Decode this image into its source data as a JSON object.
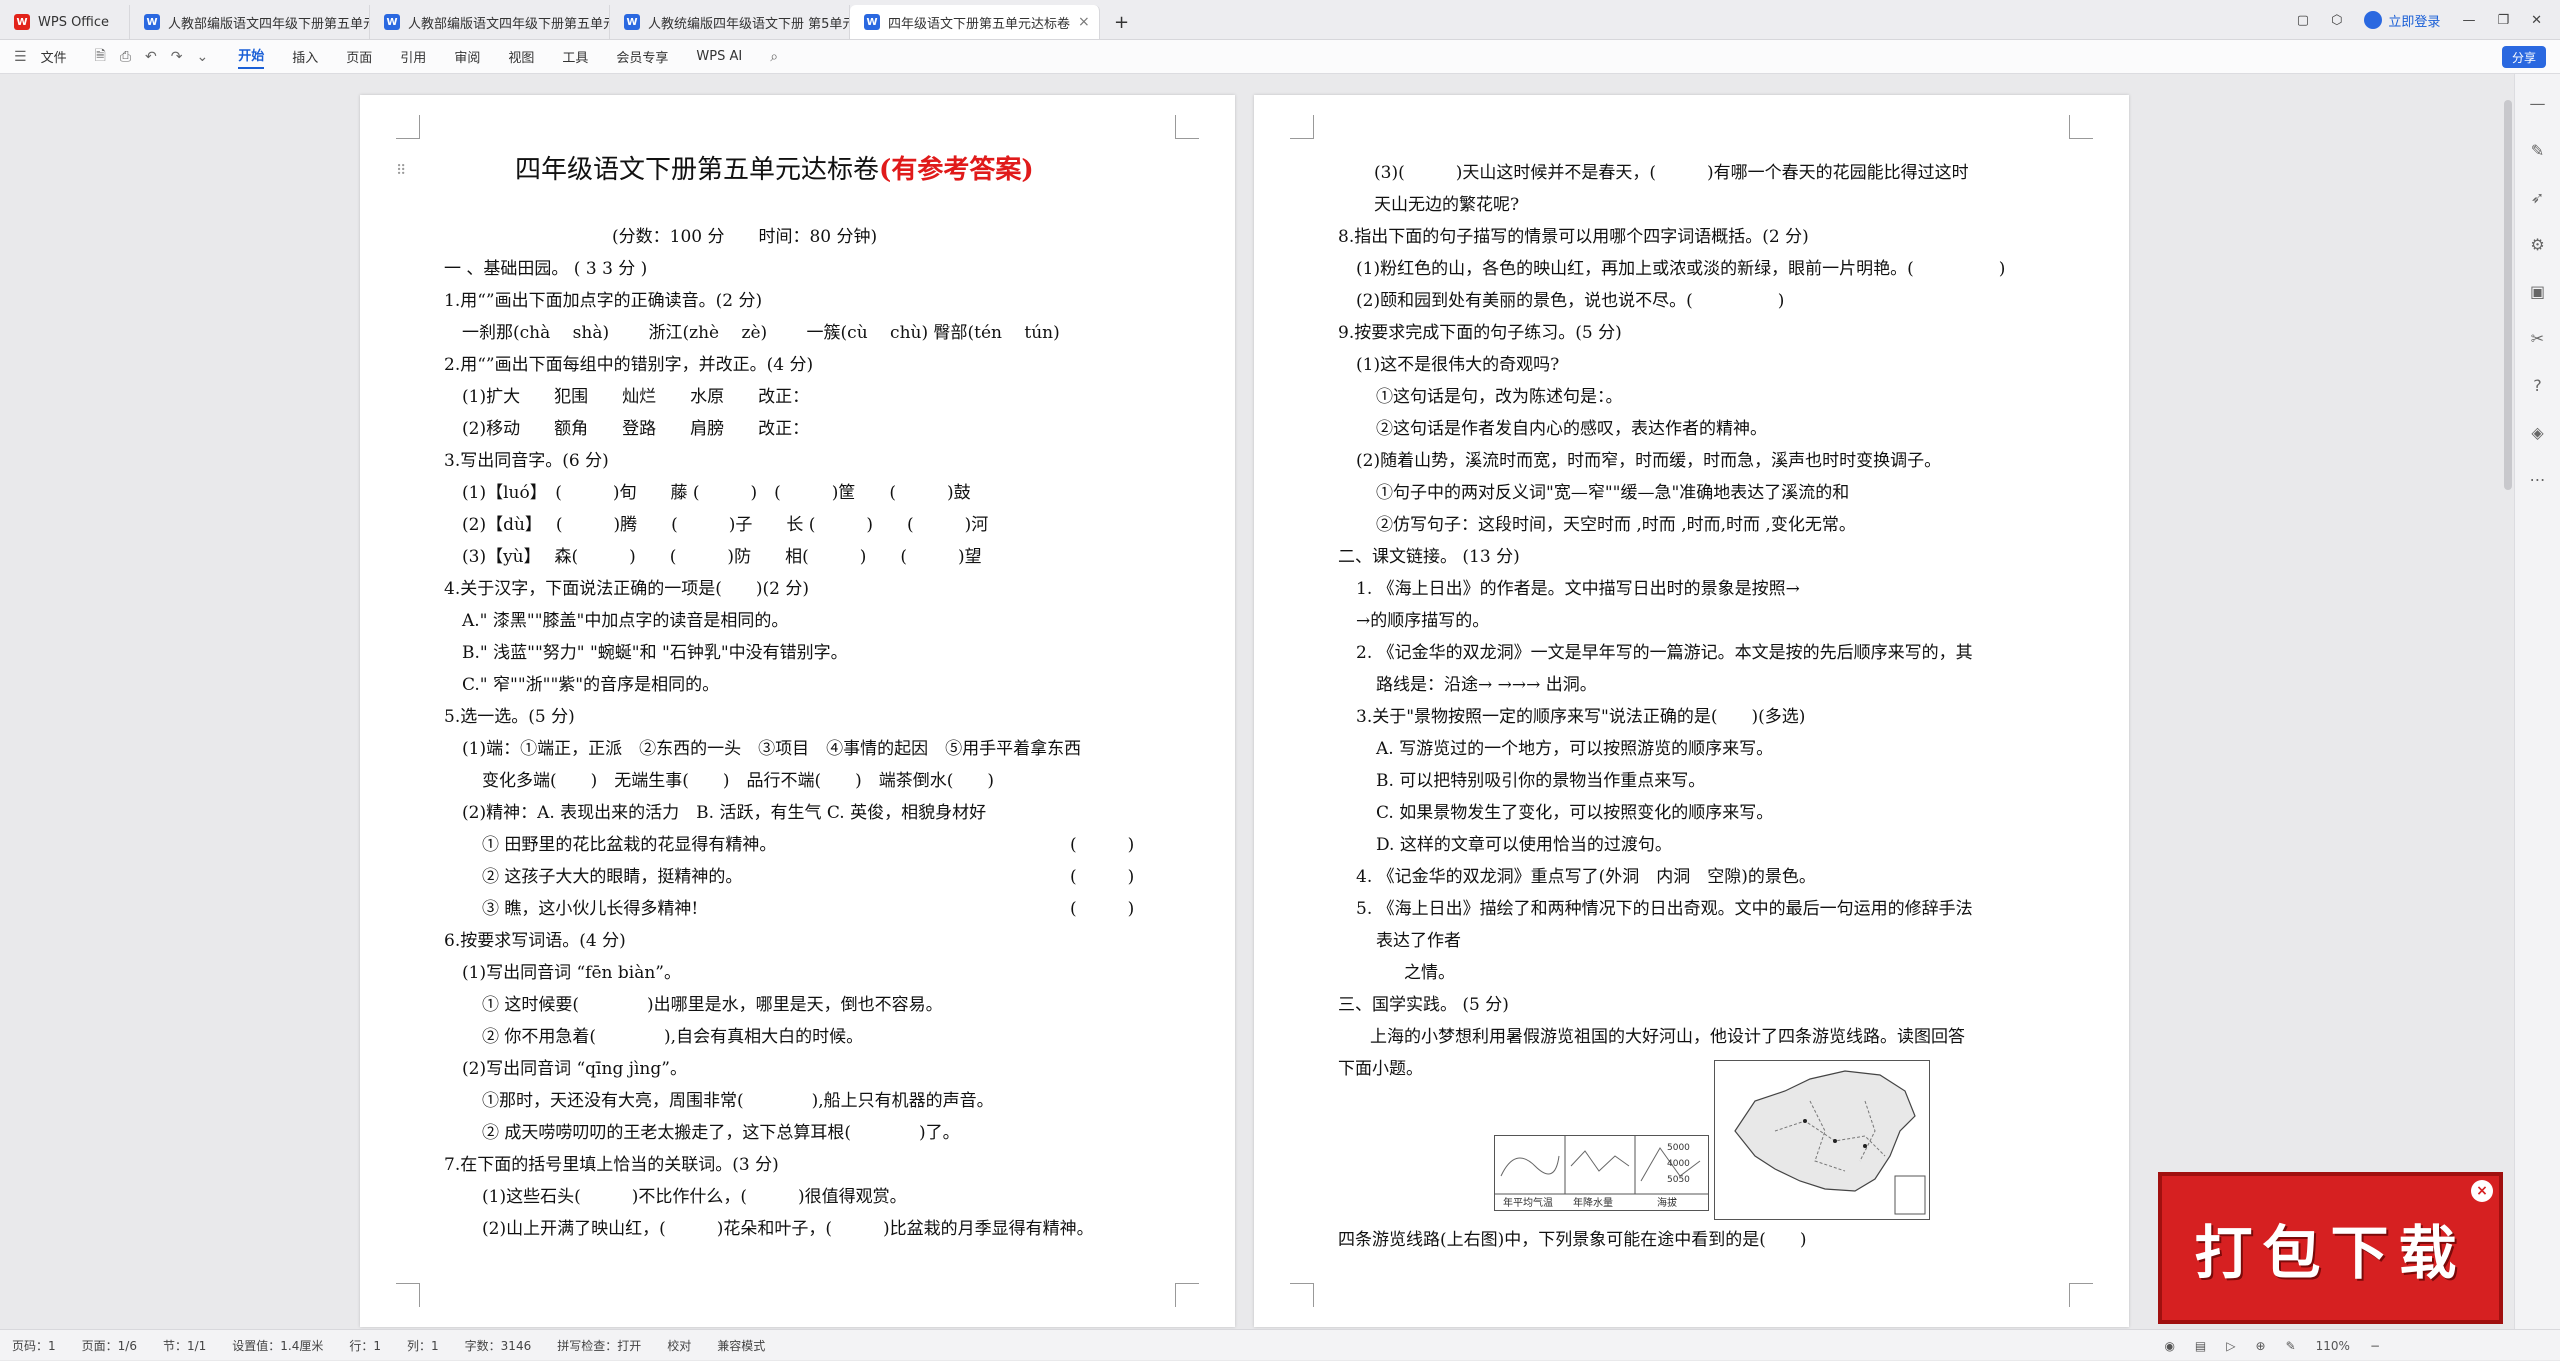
{
  "tabs": [
    {
      "label": "WPS Office",
      "icon": "wps-logo-icon",
      "color": "#e2231a"
    },
    {
      "label": "人教部编版语文四年级下册第五单元",
      "icon": "doc-icon",
      "color": "#2a68e0"
    },
    {
      "label": "人教部编版语文四年级下册第五单元",
      "icon": "doc-icon",
      "color": "#2a68e0"
    },
    {
      "label": "人教统编版四年级语文下册 第5单元",
      "icon": "doc-icon",
      "color": "#2a68e0"
    },
    {
      "label": "四年级语文下册第五单元达标卷",
      "icon": "doc-icon",
      "color": "#2a68e0"
    }
  ],
  "topbar": {
    "login_label": "立即登录"
  },
  "ribbon": {
    "file_label": "文件",
    "menus": [
      "开始",
      "插入",
      "页面",
      "引用",
      "审阅",
      "视图",
      "工具",
      "会员专享"
    ],
    "wps_ai": "WPS AI",
    "share_label": "分享"
  },
  "page1": {
    "title": "四年级语文下册第五单元达标卷",
    "title_red": "(有参考答案)",
    "lines": [
      "(分数：100 分　　时间：80 分钟)",
      "一 、基础田园。 ( 3 3  分 )",
      "1.用“”画出下面加点字的正确读音。(2 分)",
      "一刹那(chà　 shà)　　 浙江(zhè　 zè)　　 一簇(cù　 chù)  臀部(tén　 tún)",
      "2.用“”画出下面每组中的错别字，并改正。(4 分)",
      "(1)扩大　　犯围　　灿烂　　水原　　改正：",
      "(2)移动　　额角　　登路　　肩膀　　改正：",
      "3.写出同音字。(6 分)",
      "(1)【luó】　(　　　)旬　　藤 (　　　)　(　　　)筐　　(　　　)鼓",
      "(2)【dù】　 (　　　)腾　　(　　　)子　　长 (　　　)　　(　　　)河",
      "(3)【yù】　 森(　　　)　　(　　　)防　　相(　　　)　　(　　　)望",
      "4.关于汉字，下面说法正确的一项是(　　)(2 分)",
      "A.\" 漆黑\"\"膝盖\"中加点字的读音是相同的。",
      "B.\" 浅蓝\"\"努力\" \"蜿蜒\"和 \"石钟乳\"中没有错别字。",
      "C.\" 窄\"\"浙\"\"紫\"的音序是相同的。",
      "5.选一选。(5 分)",
      "(1)端：①端正，正派　②东西的一头　③项目　④事情的起因　⑤用手平着拿东西",
      "变化多端(　　)　无端生事(　　)　品行不端(　　)　端茶倒水(　　)",
      "(2)精神：A. 表现出来的活力　B. 活跃，有生气  C. 英俊，相貌身材好",
      "①  田野里的花比盆栽的花显得有精神。",
      "②  这孩子大大的眼睛，挺精神的。",
      "③  瞧，这小伙儿长得多精神!",
      "6.按要求写词语。(4 分)",
      "(1)写出同音词 “fēn biàn”。",
      "①  这时候要(　　　　)出哪里是水，哪里是天，倒也不容易。",
      "②  你不用急着(　　　　),自会有真相大白的时候。",
      "(2)写出同音词 “qīng jìng”。",
      "①那时，天还没有大亮，周围非常(　　　　),船上只有机器的声音。",
      "②  成天唠唠叨叨的王老太搬走了，这下总算耳根(　　　　)了。",
      "7.在下面的括号里填上恰当的关联词。(3 分)",
      "(1)这些石头(　　　)不比作什么，(　　　)很值得观赏。",
      "(2)山上开满了映山红，(　　　)花朵和叶子，(　　　)比盆栽的月季显得有精神。"
    ],
    "answer_parens": [
      "(　　　)",
      "(　　　)",
      "(　　　)"
    ]
  },
  "page2": {
    "lines": [
      "(3)(　　　)天山这时候并不是春天，(　　　)有哪一个春天的花园能比得过这时",
      "天山无边的繁花呢?",
      "8.指出下面的句子描写的情景可以用哪个四字词语概括。(2 分)",
      "(1)粉红色的山，各色的映山红，再加上或浓或淡的新绿，眼前一片明艳。(　　　　　)",
      "(2)颐和园到处有美丽的景色，说也说不尽。(　　　　　)",
      "9.按要求完成下面的句子练习。(5 分)",
      "(1)这不是很伟大的奇观吗?",
      "①这句话是句，改为陈述句是：。",
      "②这句话是作者发自内心的感叹，表达作者的精神。",
      "(2)随着山势，溪流时而宽，时而窄，时而缓，时而急，溪声也时时变换调子。",
      "①句子中的两对反义词\"宽—窄\"\"缓—急\"准确地表达了溪流的和",
      "②仿写句子：这段时间，天空时而 ,时而 ,时而,时而 ,变化无常。",
      "二、课文链接。 (13 分)",
      "1.  《海上日出》的作者是。文中描写日出时的景象是按照→",
      "→的顺序描写的。",
      "2.  《记金华的双龙洞》一文是早年写的一篇游记。本文是按的先后顺序来写的，其",
      "路线是：沿途→  →→→  出洞。",
      "3.关于\"景物按照一定的顺序来写\"说法正确的是(　　)(多选)",
      "A.  写游览过的一个地方，可以按照游览的顺序来写。",
      "B.  可以把特别吸引你的景物当作重点来写。",
      "C.  如果景物发生了变化，可以按照变化的顺序来写。",
      "D.  这样的文章可以使用恰当的过渡句。",
      "4.  《记金华的双龙洞》重点写了(外洞　内洞　空隙)的景色。",
      "5.  《海上日出》描绘了和两种情况下的日出奇观。文中的最后一句运用的修辞手法",
      "表达了作者",
      "之情。",
      "三、国学实践。 (5 分)",
      "上海的小梦想利用暑假游览祖国的大好河山，他设计了四条游览线路。读图回答",
      "下面小题。",
      "四条游览线路(上右图)中，下列景象可能在途中看到的是(　　)"
    ],
    "map_labels": [
      "年平均气温",
      "年降水量",
      "海拔"
    ],
    "map_numbers": [
      "5000",
      "4000",
      "5050"
    ]
  },
  "statusbar": {
    "page_no": "页码：1",
    "page_of": "页面：1/6",
    "section": "节：1/1",
    "setting": "设置值：1.4厘米",
    "row": "行：1",
    "col": "列：1",
    "word_count": "字数：3146",
    "spell": "拼写检查：打开",
    "proof": "校对",
    "compat": "兼容模式",
    "zoom": "110%"
  },
  "promo": {
    "label": "打包下载"
  }
}
